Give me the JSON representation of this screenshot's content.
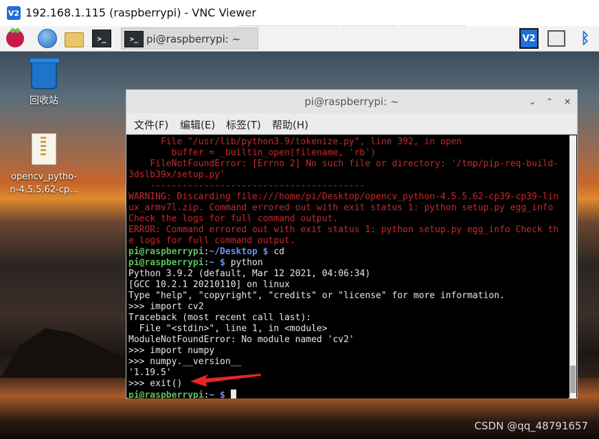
{
  "window": {
    "title": "192.168.1.115 (raspberrypi) - VNC Viewer",
    "logo_text": "V2"
  },
  "panel": {
    "task_label": "pi@raspberrypi: ~",
    "term_icon_glyph": ">_",
    "vnc_tray_text": "V2",
    "bluetooth_glyph": "ᛒ",
    "icons": [
      "raspberry-pi-menu-icon",
      "web-browser-icon",
      "file-manager-icon",
      "terminal-icon",
      "vnc-server-icon",
      "cpu-monitor-icon",
      "bluetooth-icon"
    ]
  },
  "desktop": {
    "icons": [
      {
        "label": "回收站"
      },
      {
        "label": "opencv_pytho-\nn-4.5.5.62-cp..."
      }
    ]
  },
  "terminal": {
    "title": "pi@raspberrypi: ~",
    "controls": {
      "minimize": "⌄",
      "maximize": "⌃",
      "close": "✕"
    },
    "menu": [
      "文件(F)",
      "编辑(E)",
      "标签(T)",
      "帮助(H)"
    ],
    "lines": [
      {
        "text": "      File \"/usr/lib/python3.9/tokenize.py\", line 392, in open",
        "style": "red"
      },
      {
        "text": "        buffer = _builtin_open(filename, 'rb')",
        "style": "red"
      },
      {
        "text": "    FileNotFoundError: [Errno 2] No such file or directory: '/tmp/pip-req-build-",
        "style": "red"
      },
      {
        "text": "3dslb39x/setup.py'",
        "style": "red"
      },
      {
        "text": "    ----------------------------------------",
        "style": "red"
      },
      {
        "text": "WARNING: Discarding file:///home/pi/Desktop/opencv_python-4.5.5.62-cp39-cp39-lin",
        "style": "red"
      },
      {
        "text": "ux_armv7l.zip. Command errored out with exit status 1: python setup.py egg_info",
        "style": "red"
      },
      {
        "text": "Check the logs for full command output.",
        "style": "red"
      },
      {
        "text": "ERROR: Command errored out with exit status 1: python setup.py egg_info Check th",
        "style": "red"
      },
      {
        "text": "e logs for full command output.",
        "style": "red"
      },
      {
        "text": "",
        "style": "prompt",
        "user": "pi@raspberrypi",
        "path": "~/Desktop",
        "cmd": " cd"
      },
      {
        "text": "",
        "style": "prompt",
        "user": "pi@raspberrypi",
        "path": "~",
        "cmd": " python"
      },
      {
        "text": "Python 3.9.2 (default, Mar 12 2021, 04:06:34)",
        "style": "normal"
      },
      {
        "text": "[GCC 10.2.1 20210110] on linux",
        "style": "normal"
      },
      {
        "text": "Type \"help\", \"copyright\", \"credits\" or \"license\" for more information.",
        "style": "normal"
      },
      {
        "text": ">>> import cv2",
        "style": "normal"
      },
      {
        "text": "Traceback (most recent call last):",
        "style": "normal"
      },
      {
        "text": "  File \"<stdin>\", line 1, in <module>",
        "style": "normal"
      },
      {
        "text": "ModuleNotFoundError: No module named 'cv2'",
        "style": "normal"
      },
      {
        "text": ">>> import numpy",
        "style": "normal"
      },
      {
        "text": ">>> numpy.__version__",
        "style": "normal"
      },
      {
        "text": "'1.19.5'",
        "style": "normal"
      },
      {
        "text": ">>> exit()",
        "style": "normal"
      },
      {
        "text": "",
        "style": "prompt-cursor",
        "user": "pi@raspberrypi",
        "path": "~",
        "cmd": " "
      }
    ]
  },
  "watermark": "CSDN @qq_48791657",
  "colors": {
    "error_red": "#c72a2a",
    "prompt_green": "#5ac15a",
    "prompt_blue": "#6c8ff0",
    "arrow_red": "#e8262a"
  }
}
